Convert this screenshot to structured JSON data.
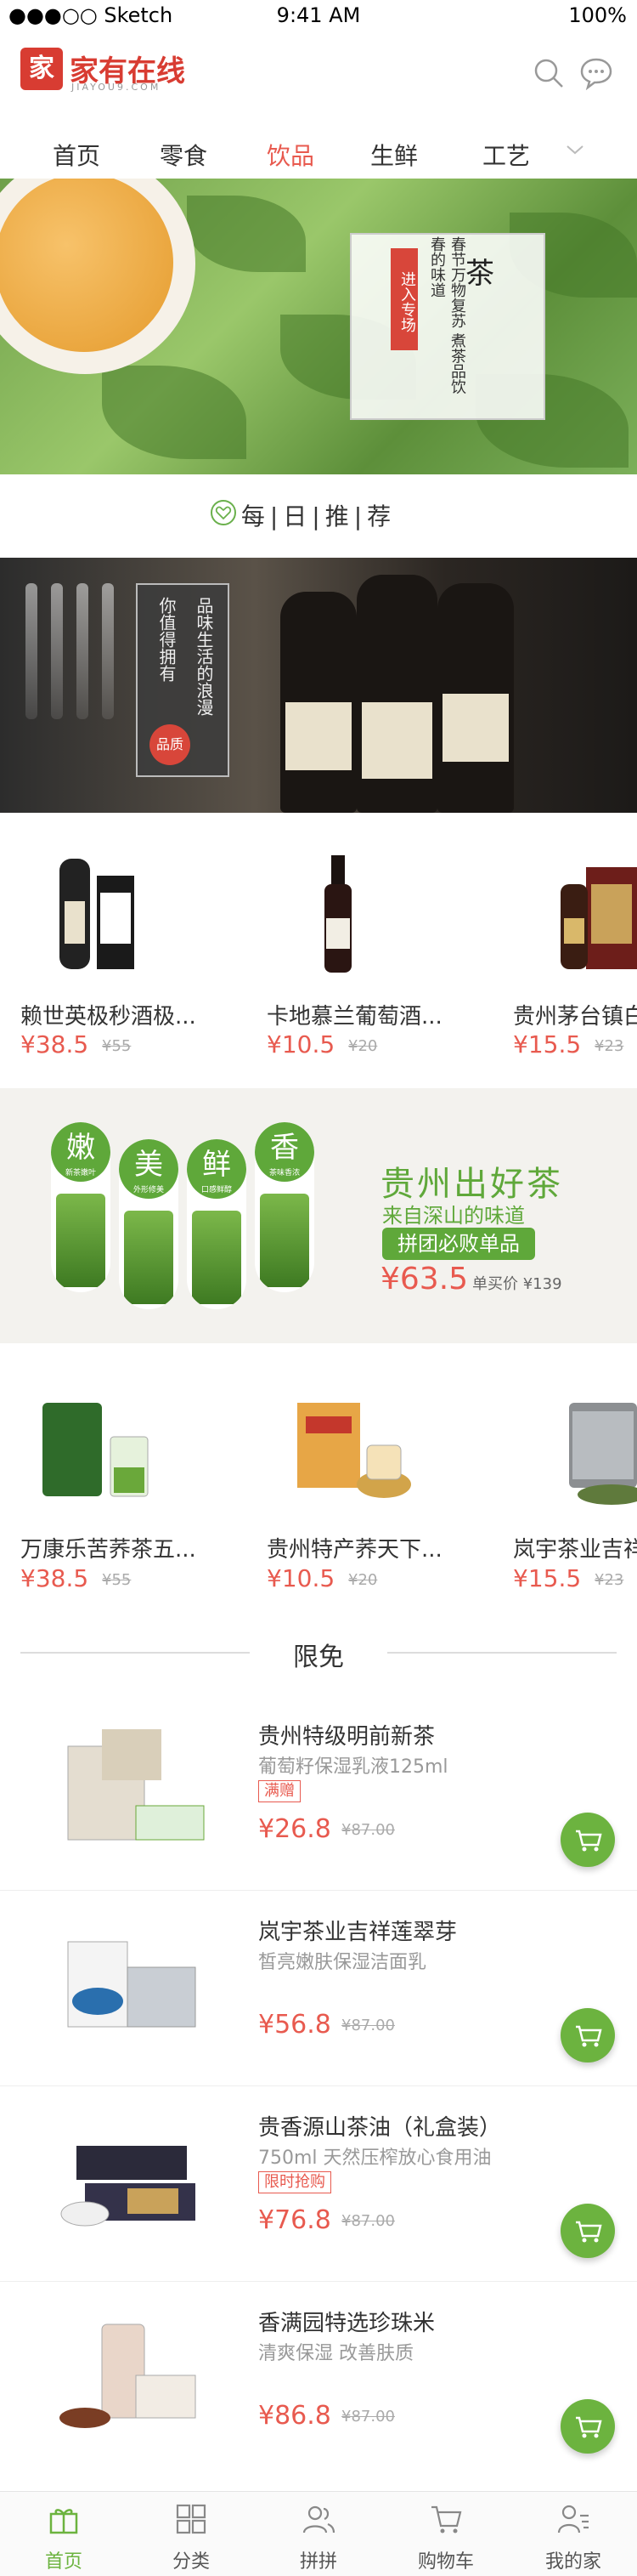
{
  "status_bar": {
    "carrier": "●●●○○ Sketch",
    "time": "9:41 AM",
    "battery": "100%"
  },
  "header": {
    "logo_char": "家",
    "logo_text": "家有在线",
    "logo_sub": "JIAYOU9.COM"
  },
  "nav": {
    "items": [
      "首页",
      "零食",
      "饮品",
      "生鲜",
      "工艺"
    ],
    "active": "饮品"
  },
  "tea_banner": {
    "enter_label": "进入专场",
    "title": "茶",
    "desc": "春节万物复苏 煮茶品饮春的味道"
  },
  "daily": {
    "title": "每|日|推|荐"
  },
  "wine_banner": {
    "line1": "品味生活的浪漫",
    "line2": "你值得拥有",
    "seal": "品质"
  },
  "wine_products": [
    {
      "name": "赖世英极秒酒极...",
      "price": "¥38.5",
      "old_price": "¥55"
    },
    {
      "name": "卡地慕兰葡萄酒...",
      "price": "¥10.5",
      "old_price": "¥20"
    },
    {
      "name": "贵州茅台镇白",
      "price": "¥15.5",
      "old_price": "¥23"
    }
  ],
  "promo": {
    "pills": [
      {
        "char": "嫩",
        "sub": "新茶嫩叶"
      },
      {
        "char": "美",
        "sub": "外形修美"
      },
      {
        "char": "鲜",
        "sub": "口感鲜醇"
      },
      {
        "char": "香",
        "sub": "茶味香浓"
      }
    ],
    "title": "贵州出好茶",
    "subtitle": "来自深山的味道",
    "badge": "拼团必败单品",
    "price": "¥63.5",
    "single_price": "单买价 ¥139"
  },
  "tea_products": [
    {
      "name": "万康乐苦荞茶五...",
      "price": "¥38.5",
      "old_price": "¥55"
    },
    {
      "name": "贵州特产荞天下...",
      "price": "¥10.5",
      "old_price": "¥20"
    },
    {
      "name": "岚宇茶业吉祥",
      "price": "¥15.5",
      "old_price": "¥23"
    }
  ],
  "limited": {
    "title": "限免",
    "items": [
      {
        "name": "贵州特级明前新茶",
        "sub": "葡萄籽保湿乳液125ml",
        "tag": "满赠",
        "price": "¥26.8",
        "old_price": "¥87.00"
      },
      {
        "name": "岚宇茶业吉祥莲翠芽",
        "sub": "皙亮嫩肤保湿洁面乳",
        "tag": "",
        "price": "¥56.8",
        "old_price": "¥87.00"
      },
      {
        "name": "贵香源山茶油（礼盒装）",
        "sub": "750ml 天然压榨放心食用油",
        "tag": "限时抢购",
        "price": "¥76.8",
        "old_price": "¥87.00"
      },
      {
        "name": "香满园特选珍珠米",
        "sub": "清爽保湿 改善肤质",
        "tag": "",
        "price": "¥86.8",
        "old_price": "¥87.00"
      }
    ]
  },
  "tabbar": {
    "items": [
      {
        "label": "首页",
        "icon": "gift-icon"
      },
      {
        "label": "分类",
        "icon": "grid-icon"
      },
      {
        "label": "拼拼",
        "icon": "users-icon"
      },
      {
        "label": "购物车",
        "icon": "cart-icon"
      },
      {
        "label": "我的家",
        "icon": "profile-icon"
      }
    ],
    "active": "首页"
  },
  "colors": {
    "brand_red": "#d83c32",
    "price_red": "#e85a4f",
    "green": "#6cb33f"
  }
}
